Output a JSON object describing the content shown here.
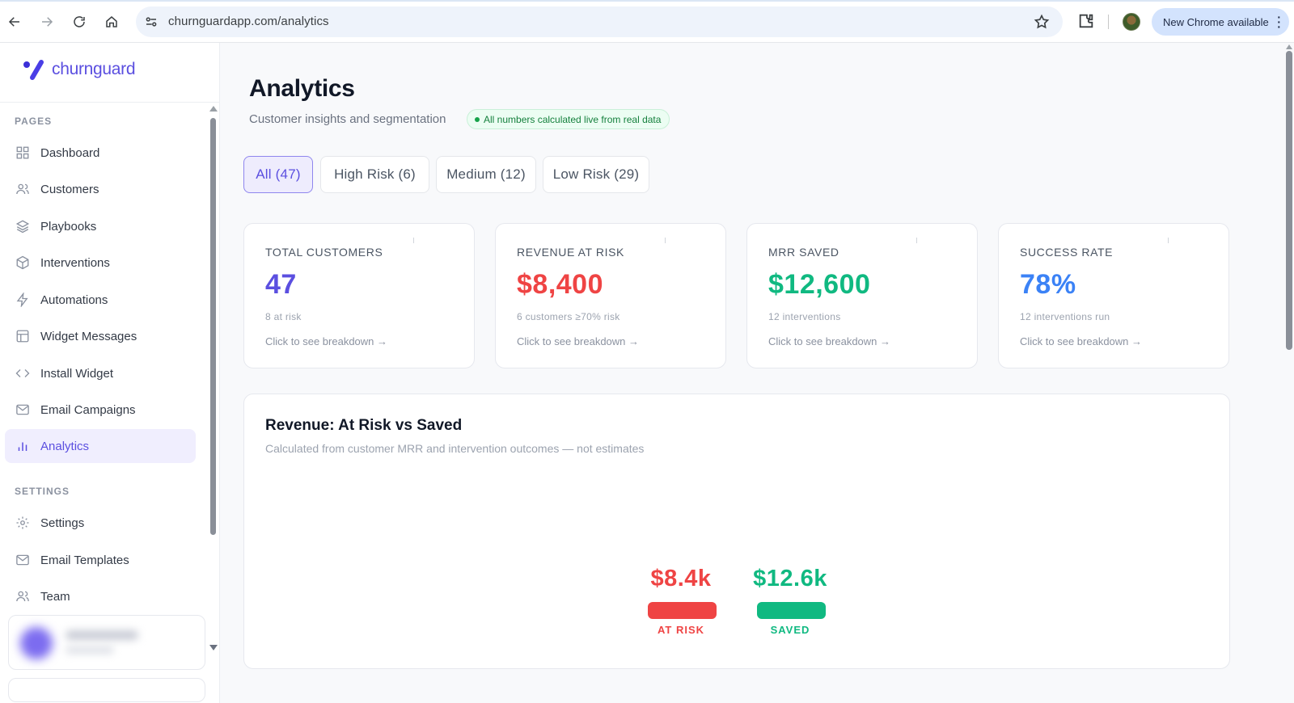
{
  "browser": {
    "url": "churnguardapp.com/analytics",
    "update_label": "New Chrome available"
  },
  "sidebar": {
    "logo_text": "churnguard",
    "pages_label": "PAGES",
    "settings_label": "SETTINGS",
    "items": [
      {
        "label": "Dashboard",
        "icon": "grid-icon"
      },
      {
        "label": "Customers",
        "icon": "users-icon"
      },
      {
        "label": "Playbooks",
        "icon": "layers-icon"
      },
      {
        "label": "Interventions",
        "icon": "box-icon"
      },
      {
        "label": "Automations",
        "icon": "zap-icon"
      },
      {
        "label": "Widget Messages",
        "icon": "layout-icon"
      },
      {
        "label": "Install Widget",
        "icon": "code-icon"
      },
      {
        "label": "Email Campaigns",
        "icon": "mail-icon"
      },
      {
        "label": "Analytics",
        "icon": "bar-chart-icon",
        "active": true
      }
    ],
    "settings_items": [
      {
        "label": "Settings",
        "icon": "gear-icon"
      },
      {
        "label": "Email Templates",
        "icon": "mail-icon"
      },
      {
        "label": "Team",
        "icon": "users-icon"
      }
    ]
  },
  "header": {
    "title": "Analytics",
    "subtitle": "Customer insights and segmentation",
    "live_badge": "All numbers calculated live from real data"
  },
  "segments": [
    {
      "label": "All (47)",
      "active": true
    },
    {
      "label": "High Risk (6)"
    },
    {
      "label": "Medium (12)"
    },
    {
      "label": "Low Risk (29)"
    }
  ],
  "kpis": [
    {
      "label": "TOTAL CUSTOMERS",
      "value": "47",
      "sub": "8 at risk",
      "link": "Click to see breakdown →",
      "color": "#5b4fe0"
    },
    {
      "label": "REVENUE AT RISK",
      "value": "$8,400",
      "sub": "6 customers ≥70% risk",
      "link": "Click to see breakdown →",
      "color": "#ef4444"
    },
    {
      "label": "MRR SAVED",
      "value": "$12,600",
      "sub": "12 interventions",
      "link": "Click to see breakdown →",
      "color": "#10b981"
    },
    {
      "label": "SUCCESS RATE",
      "value": "78%",
      "sub": "12 interventions run",
      "link": "Click to see breakdown →",
      "color": "#3b82f6"
    }
  ],
  "revenue_chart": {
    "title": "Revenue: At Risk vs Saved",
    "subtitle": "Calculated from customer MRR and intervention outcomes — not estimates"
  },
  "chart_data": {
    "type": "bar",
    "categories": [
      "AT RISK",
      "SAVED"
    ],
    "values": [
      8400,
      12600
    ],
    "value_labels": [
      "$8.4k",
      "$12.6k"
    ],
    "colors": [
      "#ef4444",
      "#10b981"
    ],
    "title": "Revenue: At Risk vs Saved"
  }
}
